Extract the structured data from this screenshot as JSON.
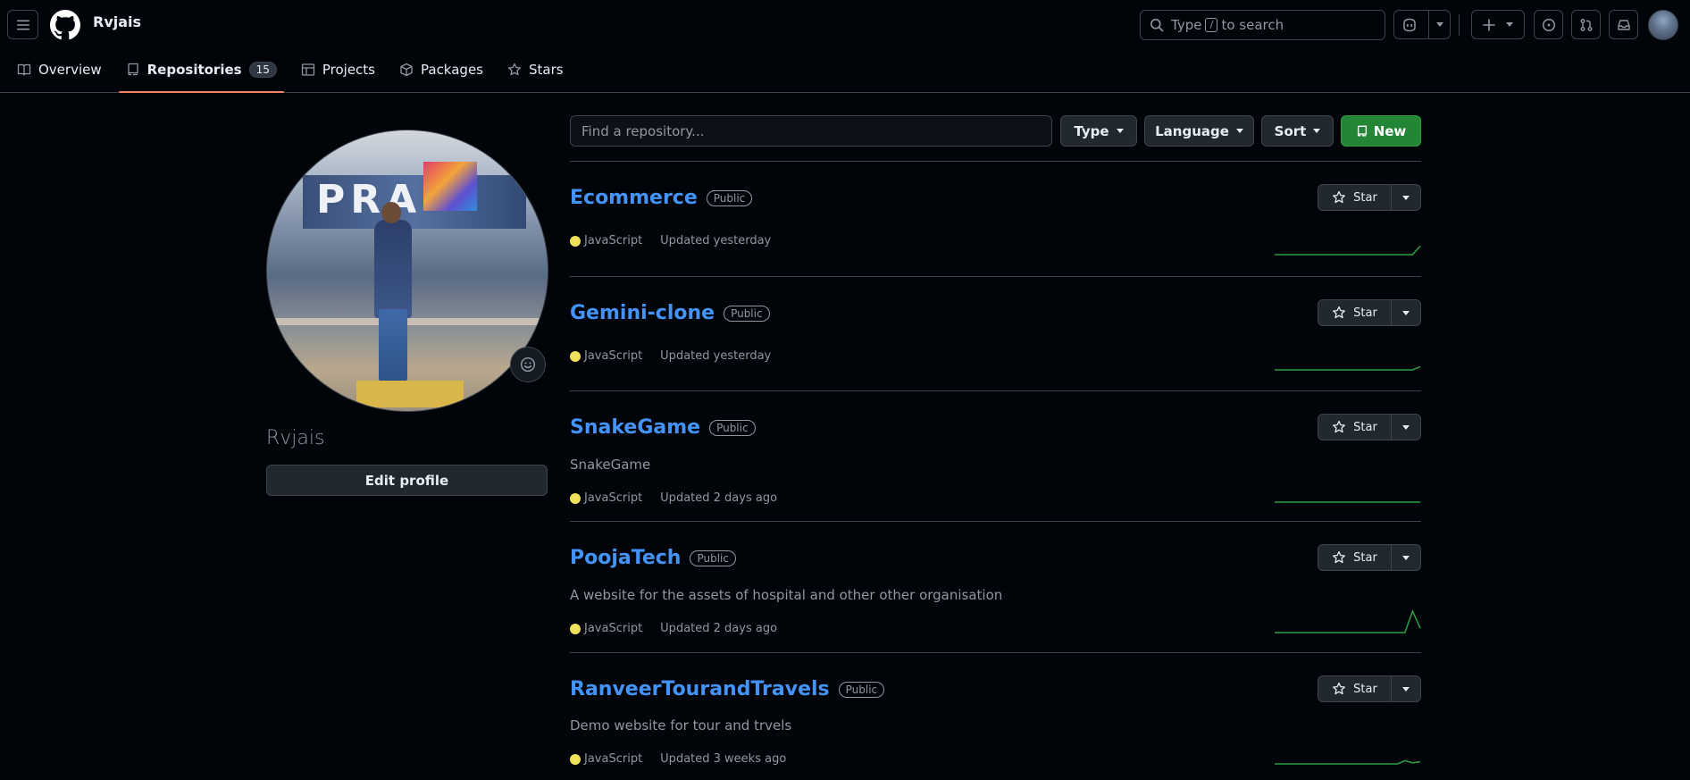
{
  "header": {
    "user": "Rvjais",
    "search": {
      "prefix": "Type",
      "key": "/",
      "suffix": "to search"
    }
  },
  "tabs": [
    {
      "label": "Overview",
      "icon": "book-icon"
    },
    {
      "label": "Repositories",
      "icon": "repo-icon",
      "count": "15",
      "selected": true
    },
    {
      "label": "Projects",
      "icon": "table-icon"
    },
    {
      "label": "Packages",
      "icon": "package-icon"
    },
    {
      "label": "Stars",
      "icon": "star-icon"
    }
  ],
  "profile": {
    "name": "Rvjais",
    "edit_label": "Edit profile",
    "avatar_sign_text": "PRA"
  },
  "filters": {
    "find_placeholder": "Find a repository...",
    "type_label": "Type",
    "language_label": "Language",
    "sort_label": "Sort",
    "new_label": "New"
  },
  "repos": [
    {
      "name": "Ecommerce",
      "visibility": "Public",
      "description": "",
      "language": "JavaScript",
      "updated": "Updated yesterday",
      "star_label": "Star",
      "activity": [
        0,
        0,
        0,
        0,
        0,
        0,
        0,
        0,
        0,
        0,
        0,
        0,
        0,
        0,
        0,
        0,
        0,
        0,
        0,
        0.4
      ]
    },
    {
      "name": "Gemini-clone",
      "visibility": "Public",
      "description": "",
      "language": "JavaScript",
      "updated": "Updated yesterday",
      "star_label": "Star",
      "activity": [
        0,
        0,
        0,
        0,
        0,
        0,
        0,
        0,
        0,
        0,
        0,
        0,
        0,
        0,
        0,
        0,
        0,
        0,
        0,
        0.15
      ]
    },
    {
      "name": "SnakeGame",
      "visibility": "Public",
      "description": "SnakeGame",
      "language": "JavaScript",
      "updated": "Updated 2 days ago",
      "star_label": "Star",
      "activity": [
        0,
        0,
        0,
        0,
        0,
        0,
        0,
        0,
        0,
        0,
        0,
        0,
        0,
        0,
        0,
        0,
        0,
        0,
        0,
        0
      ]
    },
    {
      "name": "PoojaTech",
      "visibility": "Public",
      "description": "A website for the assets of hospital and other other organisation",
      "language": "JavaScript",
      "updated": "Updated 2 days ago",
      "star_label": "Star",
      "activity": [
        0,
        0,
        0,
        0,
        0,
        0,
        0,
        0,
        0,
        0,
        0,
        0,
        0,
        0,
        0,
        0,
        0,
        0,
        1,
        0.2
      ]
    },
    {
      "name": "RanveerTourandTravels",
      "visibility": "Public",
      "description": "Demo website for tour and trvels",
      "language": "JavaScript",
      "updated": "Updated 3 weeks ago",
      "star_label": "Star",
      "activity": [
        0,
        0,
        0,
        0,
        0,
        0,
        0,
        0,
        0,
        0,
        0,
        0,
        0,
        0,
        0,
        0,
        0,
        0.15,
        0.05,
        0.1
      ]
    }
  ],
  "colors": {
    "accent_blue": "#4493f8",
    "tab_underline": "#f78166",
    "javascript": "#f1e05a",
    "new_button": "#238636",
    "sparkline": "#2ea043"
  }
}
